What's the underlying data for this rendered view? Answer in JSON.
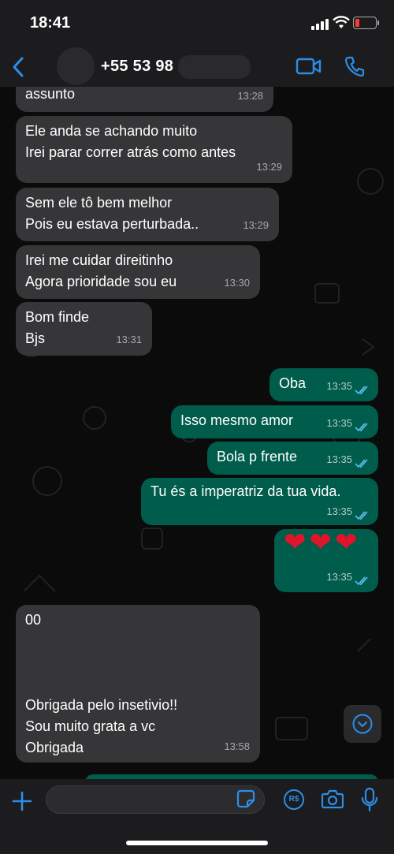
{
  "status_bar": {
    "time": "18:41"
  },
  "header": {
    "contact": "+55 53 98"
  },
  "messages": [
    {
      "dir": "in",
      "text": "assunto",
      "time": "13:28"
    },
    {
      "dir": "in",
      "text": "Ele anda se achando muito\nIrei parar correr atrás como antes",
      "time": "13:29"
    },
    {
      "dir": "in",
      "text": "Sem ele tô bem melhor\nPois eu estava perturbada..",
      "time": "13:29"
    },
    {
      "dir": "in",
      "text": "Irei me cuidar direitinho\nAgora prioridade sou eu",
      "time": "13:30"
    },
    {
      "dir": "in",
      "text": "Bom finde\nBjs",
      "time": "13:31"
    },
    {
      "dir": "out",
      "text": "Oba",
      "time": "13:35",
      "read": true
    },
    {
      "dir": "out",
      "text": "Isso mesmo amor",
      "time": "13:35",
      "read": true
    },
    {
      "dir": "out",
      "text": "Bola p frente",
      "time": "13:35",
      "read": true
    },
    {
      "dir": "out",
      "text": "Tu és a imperatriz da tua vida.",
      "time": "13:35",
      "read": true
    },
    {
      "dir": "out",
      "text": "❤❤❤",
      "time": "13:35",
      "read": true
    },
    {
      "dir": "in",
      "text": "00\n\n\n\nObrigada pelo insetivio!!\nSou muito grata a vc\nObrigada",
      "time": "13:58"
    }
  ],
  "composer": {
    "placeholder": "",
    "pay_label": "R$"
  },
  "colors": {
    "incoming": "#363638",
    "outgoing": "#005c4b",
    "accent": "#2c8ee8",
    "read_ticks": "#53bdeb"
  },
  "icons": [
    "back-icon",
    "video-call-icon",
    "phone-icon",
    "plus-icon",
    "sticker-icon",
    "payment-icon",
    "camera-icon",
    "mic-icon",
    "scroll-down-icon"
  ]
}
